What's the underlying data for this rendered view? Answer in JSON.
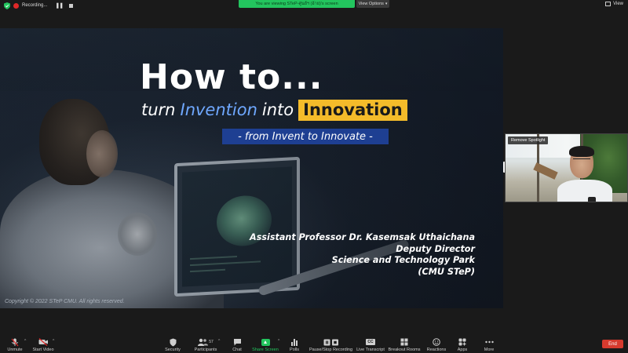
{
  "topbar": {
    "recording_label": "Recording...",
    "banner_text": "You are viewing STeP-ศูนย์ฯ (อ้าย)'s screen",
    "view_options_label": "View Options",
    "view_label": "View"
  },
  "slide": {
    "title": "How to...",
    "subtitle_turn": "turn",
    "subtitle_invention": "Invention",
    "subtitle_into": "into",
    "subtitle_innovation": "Innovation",
    "tagline": "- from Invent to Innovate -",
    "presenter_lines": [
      "Assistant Professor Dr. Kasemsak Uthaichana",
      "Deputy Director",
      "Science and Technology Park",
      "(CMU STeP)"
    ],
    "copyright": "Copyright © 2022 STeP CMU. All rights reserved.",
    "colors": {
      "accent_blue": "#6fa8ff",
      "highlight_yellow": "#f4bb2a",
      "tagline_bg": "#1e3f92"
    }
  },
  "video_tile": {
    "remove_spotlight_label": "Remove Spotlight"
  },
  "toolbar": {
    "unmute": "Unmute",
    "start_video": "Start Video",
    "security": "Security",
    "participants": "Participants",
    "participants_count": "57",
    "chat": "Chat",
    "share_screen": "Share Screen",
    "polls": "Polls",
    "pause_stop_recording": "Pause/Stop Recording",
    "live_transcript": "Live Transcript",
    "live_transcript_badge": "CC",
    "breakout_rooms": "Breakout Rooms",
    "reactions": "Reactions",
    "apps": "Apps",
    "more": "More",
    "end": "End",
    "colors": {
      "share_green": "#23c55e",
      "end_red": "#d63a2e"
    }
  }
}
